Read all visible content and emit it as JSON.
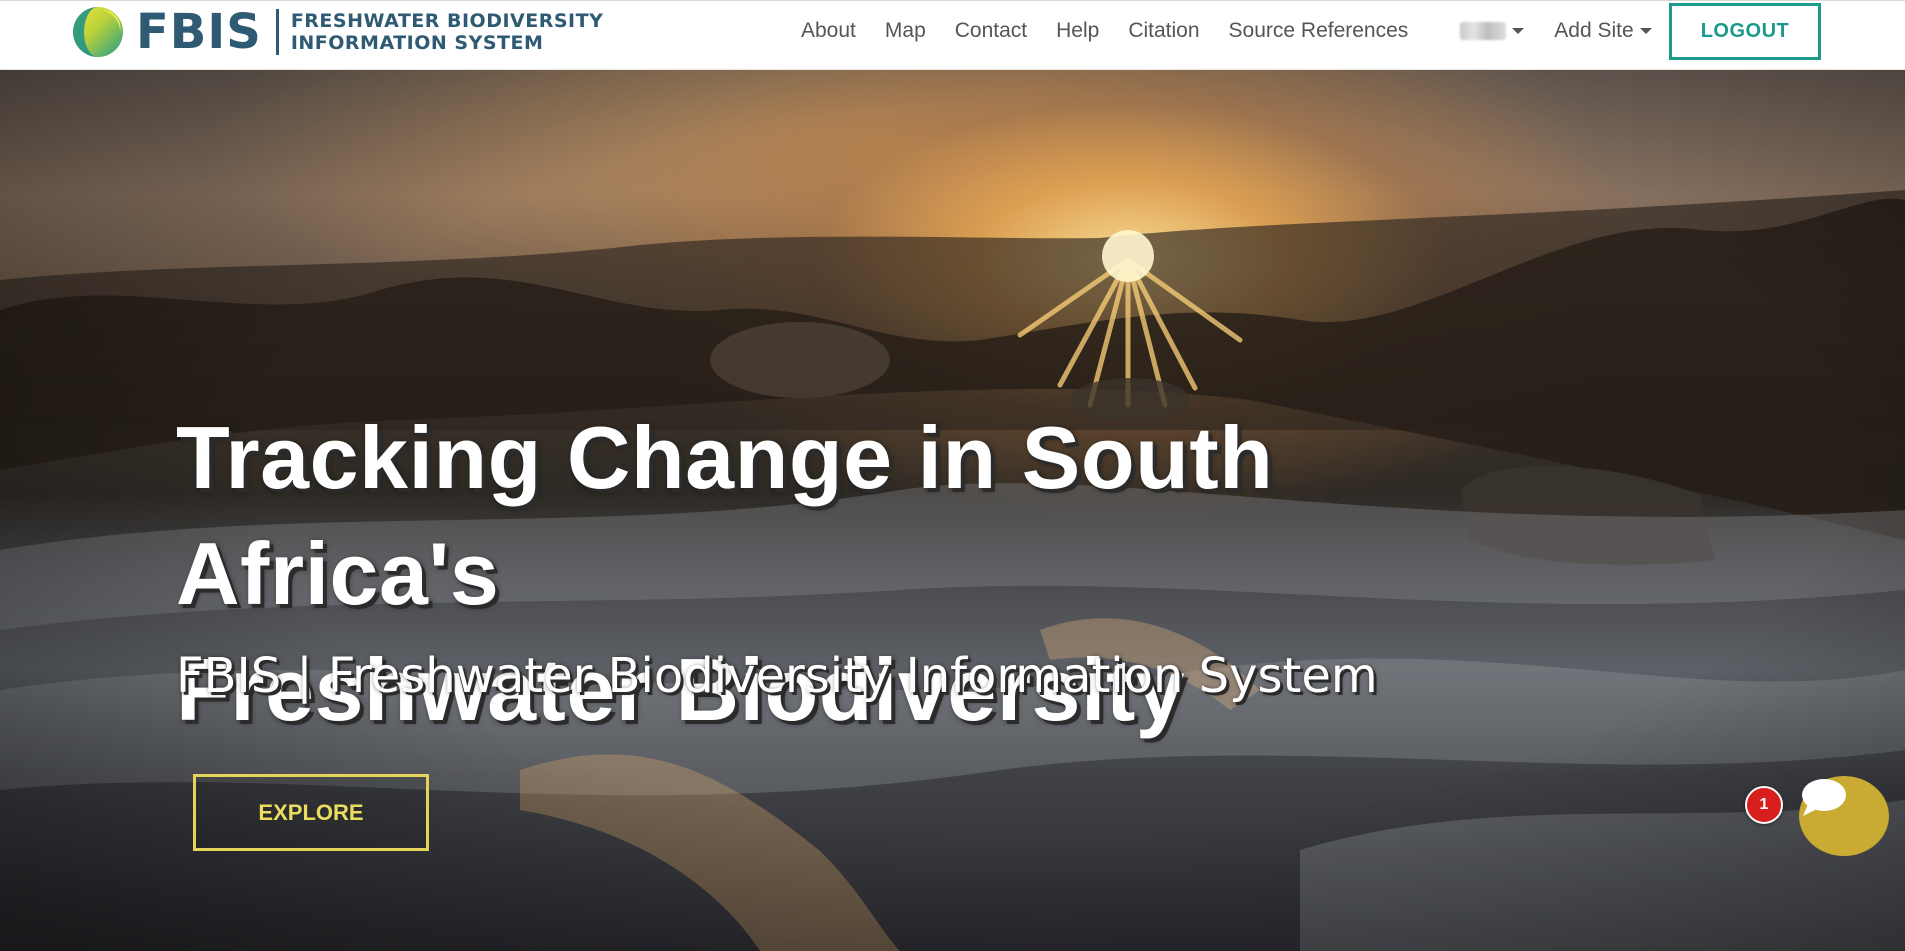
{
  "navbar": {
    "brand_short": "FBIS",
    "brand_line1": "FRESHWATER BIODIVERSITY",
    "brand_line2": "INFORMATION SYSTEM",
    "links": [
      {
        "label": "About"
      },
      {
        "label": "Map"
      },
      {
        "label": "Contact"
      },
      {
        "label": "Help"
      },
      {
        "label": "Citation"
      },
      {
        "label": "Source References"
      }
    ],
    "add_site_label": "Add Site",
    "logout_label": "LOGOUT"
  },
  "hero": {
    "title_line1": "Tracking Change in South Africa's",
    "title_line2": "Freshwater Biodiversity",
    "subtitle": "FBIS | Freshwater Biodiversity Information System",
    "explore_label": "EXPLORE"
  },
  "chat": {
    "badge_count": "1",
    "icon": "chat-bubble-icon"
  },
  "colors": {
    "brand_blue": "#2e5a73",
    "logout_teal": "#1b9a8c",
    "explore_yellow": "#e5d45a",
    "chat_gold": "#c9aa32",
    "badge_red": "#d91e1e"
  }
}
